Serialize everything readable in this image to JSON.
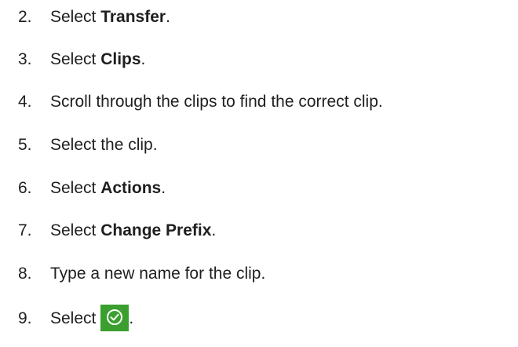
{
  "steps": [
    {
      "number": "2.",
      "pre": "Select ",
      "bold": "Transfer",
      "post": "."
    },
    {
      "number": "3.",
      "pre": "Select ",
      "bold": "Clips",
      "post": "."
    },
    {
      "number": "4.",
      "pre": "Scroll through the clips to find the correct clip.",
      "bold": "",
      "post": ""
    },
    {
      "number": "5.",
      "pre": "Select the clip.",
      "bold": "",
      "post": ""
    },
    {
      "number": "6.",
      "pre": "Select ",
      "bold": "Actions",
      "post": "."
    },
    {
      "number": "7.",
      "pre": "Select ",
      "bold": "Change Prefix",
      "post": "."
    },
    {
      "number": "8.",
      "pre": "Type a new name for the clip.",
      "bold": "",
      "post": ""
    },
    {
      "number": "9.",
      "pre": "Select",
      "icon": "check-circle-icon",
      "post": "."
    }
  ],
  "colors": {
    "text": "#1f1f1f",
    "confirm_button_bg": "#3a9f2e",
    "confirm_icon": "#ffffff"
  }
}
